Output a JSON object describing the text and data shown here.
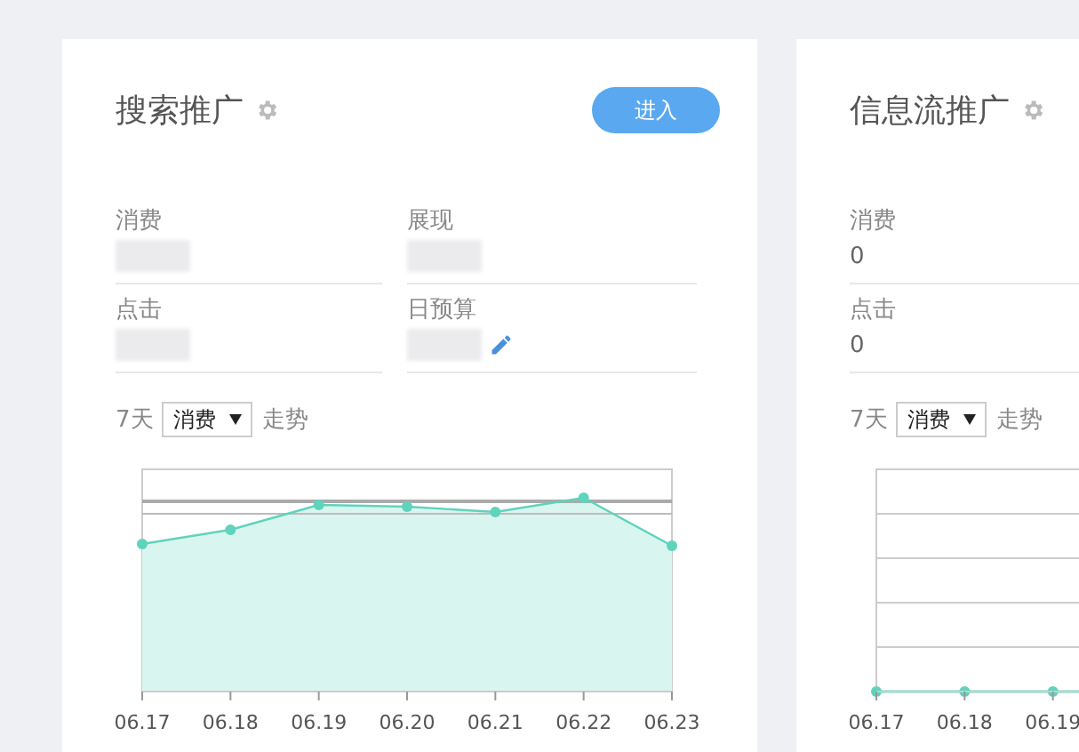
{
  "cards": [
    {
      "title": "搜索推广",
      "button": "进入",
      "rows": [
        [
          {
            "label": "消费",
            "redacted": true,
            "editable": false
          },
          {
            "label": "展现",
            "redacted": true,
            "editable": false
          }
        ],
        [
          {
            "label": "点击",
            "redacted": true,
            "editable": false
          },
          {
            "label": "日预算",
            "redacted": true,
            "editable": true
          }
        ]
      ],
      "trend": {
        "prefix": "7天",
        "select": "消费",
        "suffix": "走势"
      },
      "chart": {
        "kind": "trend",
        "dates": [
          "06.17",
          "06.18",
          "06.19",
          "06.20",
          "06.21",
          "06.22",
          "06.23"
        ]
      }
    },
    {
      "title": "信息流推广",
      "rows": [
        [
          {
            "label": "消费",
            "value": "0",
            "redacted": false,
            "editable": false
          }
        ],
        [
          {
            "label": "点击",
            "value": "0",
            "redacted": false,
            "editable": false
          }
        ]
      ],
      "trend": {
        "prefix": "7天",
        "select": "消费",
        "suffix": "走势"
      },
      "chart": {
        "kind": "flat",
        "dates": [
          "06.17",
          "06.18",
          "06.19"
        ]
      }
    }
  ]
}
